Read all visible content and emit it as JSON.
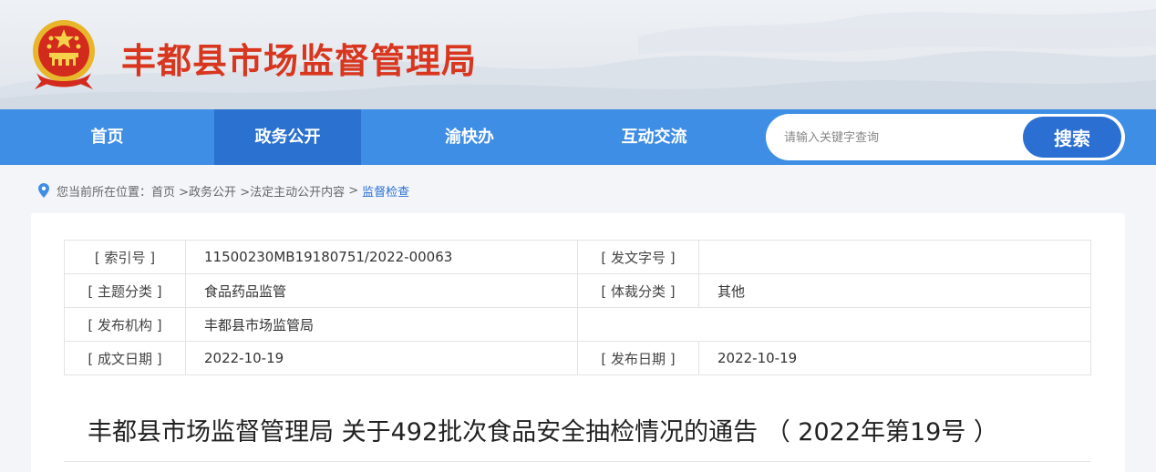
{
  "header": {
    "site_title": "丰都县市场监督管理局",
    "emblem_icon": "national-emblem-icon"
  },
  "nav": {
    "items": [
      {
        "label": "首页",
        "active": false
      },
      {
        "label": "政务公开",
        "active": true
      },
      {
        "label": "渝快办",
        "active": false
      },
      {
        "label": "互动交流",
        "active": false
      }
    ]
  },
  "search": {
    "placeholder": "请输入关键字查询",
    "value": "",
    "button_label": "搜索"
  },
  "breadcrumb": {
    "prefix": "您当前所在位置：",
    "items": [
      "首页",
      " >政务公开",
      " >法定主动公开内容",
      " >",
      "监督检查"
    ]
  },
  "meta": {
    "index_label": "[ 索引号 ]",
    "index_value": "11500230MB19180751/2022-00063",
    "docno_label": "[ 发文字号 ]",
    "docno_value": "",
    "topic_label": "[ 主题分类 ]",
    "topic_value": "食品药品监管",
    "genre_label": "[ 体裁分类 ]",
    "genre_value": "其他",
    "publisher_label": "[ 发布机构 ]",
    "publisher_value": "丰都县市场监管局",
    "created_label": "[ 成文日期 ]",
    "created_value": "2022-10-19",
    "published_label": "[ 发布日期 ]",
    "published_value": "2022-10-19"
  },
  "document": {
    "title": "丰都县市场监督管理局 关于492批次食品安全抽检情况的通告 （ 2022年第19号 ）"
  },
  "colors": {
    "brand_red": "#d8361e",
    "nav_blue": "#3f8ee5",
    "nav_active": "#2b71cf",
    "search_button": "#2b6fd3"
  }
}
